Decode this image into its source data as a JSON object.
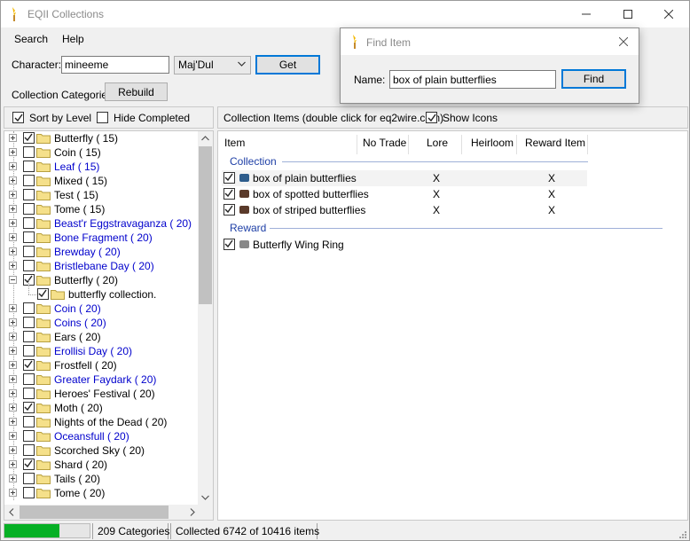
{
  "window": {
    "title": "EQII Collections"
  },
  "menu": [
    "Search",
    "Help"
  ],
  "character": {
    "label": "Character:",
    "value": "mineeme",
    "server": "Maj'Dul",
    "get_label": "Get"
  },
  "categories": {
    "label": "Collection Categories",
    "rebuild_label": "Rebuild"
  },
  "left_options": {
    "sort_by_level": "Sort by Level",
    "sort_checked": true,
    "hide_completed": "Hide Completed",
    "hide_checked": false
  },
  "tree": [
    {
      "label": "Butterfly ( 15)",
      "checked": true,
      "blue": false,
      "expanded": false
    },
    {
      "label": "Coin ( 15)",
      "checked": false,
      "blue": false,
      "expanded": false
    },
    {
      "label": "Leaf ( 15)",
      "checked": false,
      "blue": true,
      "expanded": false
    },
    {
      "label": "Mixed ( 15)",
      "checked": false,
      "blue": false,
      "expanded": false
    },
    {
      "label": "Test ( 15)",
      "checked": false,
      "blue": false,
      "expanded": false
    },
    {
      "label": "Tome ( 15)",
      "checked": false,
      "blue": false,
      "expanded": false
    },
    {
      "label": "Beast'r Eggstravaganza ( 20)",
      "checked": false,
      "blue": true,
      "expanded": false
    },
    {
      "label": "Bone Fragment ( 20)",
      "checked": false,
      "blue": true,
      "expanded": false
    },
    {
      "label": "Brewday ( 20)",
      "checked": false,
      "blue": true,
      "expanded": false
    },
    {
      "label": "Bristlebane Day ( 20)",
      "checked": false,
      "blue": true,
      "expanded": false
    },
    {
      "label": "Butterfly ( 20)",
      "checked": true,
      "blue": false,
      "expanded": true
    },
    {
      "label": "butterfly collection.",
      "checked": true,
      "blue": false,
      "child": true
    },
    {
      "label": "Coin ( 20)",
      "checked": false,
      "blue": true,
      "expanded": false
    },
    {
      "label": "Coins ( 20)",
      "checked": false,
      "blue": true,
      "expanded": false
    },
    {
      "label": "Ears ( 20)",
      "checked": false,
      "blue": false,
      "expanded": false
    },
    {
      "label": "Erollisi Day ( 20)",
      "checked": false,
      "blue": true,
      "expanded": false
    },
    {
      "label": "Frostfell ( 20)",
      "checked": true,
      "blue": false,
      "expanded": false
    },
    {
      "label": "Greater Faydark ( 20)",
      "checked": false,
      "blue": true,
      "expanded": false
    },
    {
      "label": "Heroes' Festival ( 20)",
      "checked": false,
      "blue": false,
      "expanded": false
    },
    {
      "label": "Moth ( 20)",
      "checked": true,
      "blue": false,
      "expanded": false
    },
    {
      "label": "Nights of the Dead ( 20)",
      "checked": false,
      "blue": false,
      "expanded": false
    },
    {
      "label": "Oceansfull ( 20)",
      "checked": false,
      "blue": true,
      "expanded": false
    },
    {
      "label": "Scorched Sky ( 20)",
      "checked": false,
      "blue": false,
      "expanded": false
    },
    {
      "label": "Shard ( 20)",
      "checked": true,
      "blue": false,
      "expanded": false
    },
    {
      "label": "Tails ( 20)",
      "checked": false,
      "blue": false,
      "expanded": false
    },
    {
      "label": "Tome ( 20)",
      "checked": false,
      "blue": false,
      "expanded": false
    }
  ],
  "right_header": {
    "label": "Collection Items (double click for eq2wire.com)",
    "show_icons": "Show Icons",
    "show_icons_checked": true
  },
  "columns": [
    "Item",
    "No Trade",
    "Lore",
    "Heirloom",
    "Reward Item"
  ],
  "groups": [
    {
      "name": "Collection",
      "items": [
        {
          "name": "box of plain butterflies",
          "checked": true,
          "icon_color": "#2e5d8c",
          "lore": "X",
          "reward": "X",
          "selected": true
        },
        {
          "name": "box of spotted butterflies",
          "checked": true,
          "icon_color": "#5a3a2a",
          "lore": "X",
          "reward": "X",
          "selected": false
        },
        {
          "name": "box of striped butterflies",
          "checked": true,
          "icon_color": "#5a3a2a",
          "lore": "X",
          "reward": "X",
          "selected": false
        }
      ]
    },
    {
      "name": "Reward",
      "items": [
        {
          "name": "Butterfly Wing Ring",
          "checked": true,
          "icon_color": "#888888",
          "lore": "",
          "reward": "",
          "selected": false
        }
      ]
    }
  ],
  "status": {
    "progress": 0.65,
    "categories": "209 Categories",
    "collected": "Collected 6742 of 10416 items",
    "progress_color": "#06b025"
  },
  "find_dialog": {
    "title": "Find Item",
    "name_label": "Name:",
    "value": "box of plain butterflies",
    "find_label": "Find"
  }
}
